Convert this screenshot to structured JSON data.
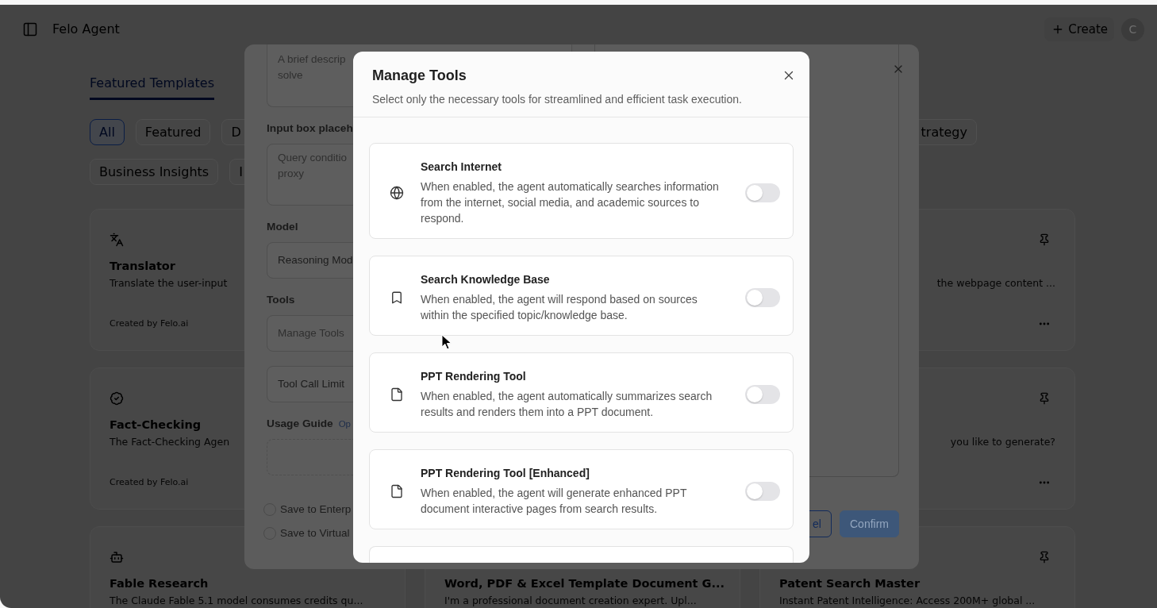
{
  "header": {
    "title": "Felo Agent",
    "create_label": "Create",
    "avatar": "C"
  },
  "tabs": [
    {
      "label": "Featured Templates",
      "selected": true
    }
  ],
  "category_rows": [
    {
      "chips": [
        {
          "label": "All",
          "selected": true
        },
        {
          "label": "Featured",
          "selected": false
        },
        {
          "label": "D",
          "selected": false
        }
      ],
      "chips_right": [
        {
          "label": "trategy",
          "selected": false
        }
      ]
    },
    {
      "chips": [
        {
          "label": "Business Insights",
          "selected": false
        },
        {
          "label": "I",
          "selected": false
        }
      ]
    }
  ],
  "card_columns": [
    {
      "cards": [
        {
          "kind": "translate",
          "title": "Translator",
          "description": "Translate the user-input",
          "author": "Created by Felo.ai"
        },
        {
          "kind": "badge",
          "title": "Fact-Checking",
          "description": "The Fact-Checking Agen",
          "author": "Created by Felo.ai"
        },
        {
          "kind": "robot",
          "title": "Fable Research",
          "description": "The Claude Fable 5.1 model consumes credits qu..."
        }
      ]
    },
    {
      "cards": [
        {
          "title": "Word, PDF & Excel Template Document G...",
          "description": "I'm a professional document creation expert. Upl..."
        }
      ]
    },
    {
      "cards": [
        {
          "pin_button": true,
          "description": "the webpage content ...",
          "more_button": true
        },
        {
          "pin_button": true,
          "description": "you like to generate?",
          "more_button": true
        },
        {
          "pin_button": true,
          "title": "Patent Search Master",
          "description": "Instant Patent Intelligence: Access 200M+ global ..."
        }
      ]
    }
  ],
  "edit_dialog": {
    "fields": [
      {
        "kind": "textarea",
        "placeholder": "A brief descrip\nsolve"
      },
      {
        "kind": "textarea",
        "label": "Input box placeh",
        "placeholder": "Query conditio\nproxy"
      },
      {
        "kind": "select",
        "label": "Model",
        "value": "Reasoning Mod"
      },
      {
        "kind": "button",
        "label": "Tools",
        "value": "Manage Tools"
      },
      {
        "kind": "setting",
        "value": "Tool Call Limit"
      },
      {
        "kind": "upload",
        "label": "Usage Guide",
        "hint": "Op"
      }
    ],
    "options": [
      {
        "label": "Save to Enterp",
        "checked": false
      },
      {
        "label": "Save to Virtual",
        "checked": false
      }
    ],
    "buttons": [
      {
        "kind": "secondary",
        "label": "el"
      },
      {
        "kind": "primary",
        "label": "Confirm"
      }
    ]
  },
  "manage_tools": {
    "title": "Manage Tools",
    "subtitle": "Select only the necessary tools for streamlined and efficient task execution.",
    "tools": [
      {
        "kind": "tool",
        "name": "Search Internet",
        "description": "When enabled, the agent automatically searches information from the internet, social media, and academic sources to respond.",
        "on": false
      },
      {
        "kind": "tool",
        "name": "Search Knowledge Base",
        "description": "When enabled, the agent will respond based on sources within the specified topic/knowledge base.",
        "on": false
      },
      {
        "kind": "tool",
        "name": "PPT Rendering Tool",
        "description": "When enabled, the agent automatically summarizes search results and renders them into a PPT document.",
        "on": false
      },
      {
        "kind": "tool",
        "name": "PPT Rendering Tool [Enhanced]",
        "description": "When enabled, the agent will generate enhanced PPT document interactive pages from search results.",
        "on": false
      },
      {
        "kind": "peek"
      }
    ]
  }
}
